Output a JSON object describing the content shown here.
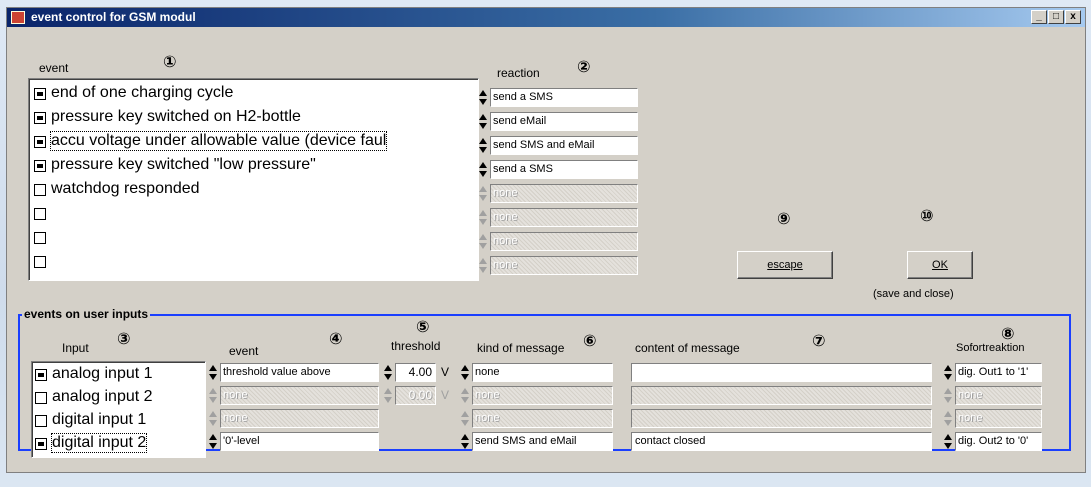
{
  "window": {
    "title": "event control for GSM modul",
    "buttons": [
      "_",
      "□",
      "x"
    ]
  },
  "event_section": {
    "event_label": "event",
    "reaction_label": "reaction",
    "marker_event": "①",
    "marker_reaction": "②",
    "events": [
      {
        "text": "end of one charging cycle",
        "checked": true
      },
      {
        "text": "pressure key switched on H2-bottle",
        "checked": true
      },
      {
        "text": "accu voltage under allowable value (device faul",
        "checked": true,
        "focused": true
      },
      {
        "text": "pressure key switched \"low pressure\"",
        "checked": true
      },
      {
        "text": "watchdog responded",
        "checked": false
      },
      {
        "text": "",
        "checked": false
      },
      {
        "text": "",
        "checked": false
      },
      {
        "text": "",
        "checked": false
      }
    ],
    "reactions": [
      {
        "value": "send a SMS",
        "enabled": true
      },
      {
        "value": "send eMail",
        "enabled": true
      },
      {
        "value": "send SMS and eMail",
        "enabled": true
      },
      {
        "value": "send a SMS",
        "enabled": true
      },
      {
        "value": "none",
        "enabled": false
      },
      {
        "value": "none",
        "enabled": false
      },
      {
        "value": "none",
        "enabled": false
      },
      {
        "value": "none",
        "enabled": false
      }
    ]
  },
  "buttons": {
    "escape_label": "escape",
    "ok_label": "OK",
    "save_note": "(save and close)",
    "marker_escape": "⑨",
    "marker_ok": "⑩"
  },
  "user_inputs": {
    "group_title": "events on user inputs",
    "headers": {
      "input": "Input",
      "event": "event",
      "threshold": "threshold",
      "kind": "kind of message",
      "content": "content of message",
      "sofort": "Sofortreaktion"
    },
    "markers": {
      "input": "③",
      "event": "④",
      "threshold": "⑤",
      "kind": "⑥",
      "content": "⑦",
      "sofort": "⑧"
    },
    "rows": [
      {
        "input": "analog input 1",
        "checked": true,
        "event": "threshold value above",
        "event_enabled": true,
        "threshold": "4.00",
        "unit": "V",
        "threshold_visible": true,
        "threshold_enabled": true,
        "kind": "none",
        "kind_enabled": true,
        "content": "",
        "content_enabled": true,
        "sofort": "dig. Out1 to '1'",
        "sofort_enabled": true
      },
      {
        "input": "analog input 2",
        "checked": false,
        "event": "none",
        "event_enabled": false,
        "threshold": "0.00",
        "unit": "V",
        "threshold_visible": true,
        "threshold_enabled": false,
        "kind": "none",
        "kind_enabled": false,
        "content": "",
        "content_enabled": false,
        "sofort": "none",
        "sofort_enabled": false
      },
      {
        "input": "digital input 1",
        "checked": false,
        "event": "none",
        "event_enabled": false,
        "threshold": "",
        "unit": "",
        "threshold_visible": false,
        "threshold_enabled": false,
        "kind": "none",
        "kind_enabled": false,
        "content": "",
        "content_enabled": false,
        "sofort": "none",
        "sofort_enabled": false
      },
      {
        "input": "digital input 2",
        "checked": true,
        "focused": true,
        "event": "'0'-level",
        "event_enabled": true,
        "threshold": "",
        "unit": "",
        "threshold_visible": false,
        "threshold_enabled": false,
        "kind": "send SMS and eMail",
        "kind_enabled": true,
        "content": "contact closed",
        "content_enabled": true,
        "sofort": "dig. Out2 to '0'",
        "sofort_enabled": true
      }
    ]
  }
}
